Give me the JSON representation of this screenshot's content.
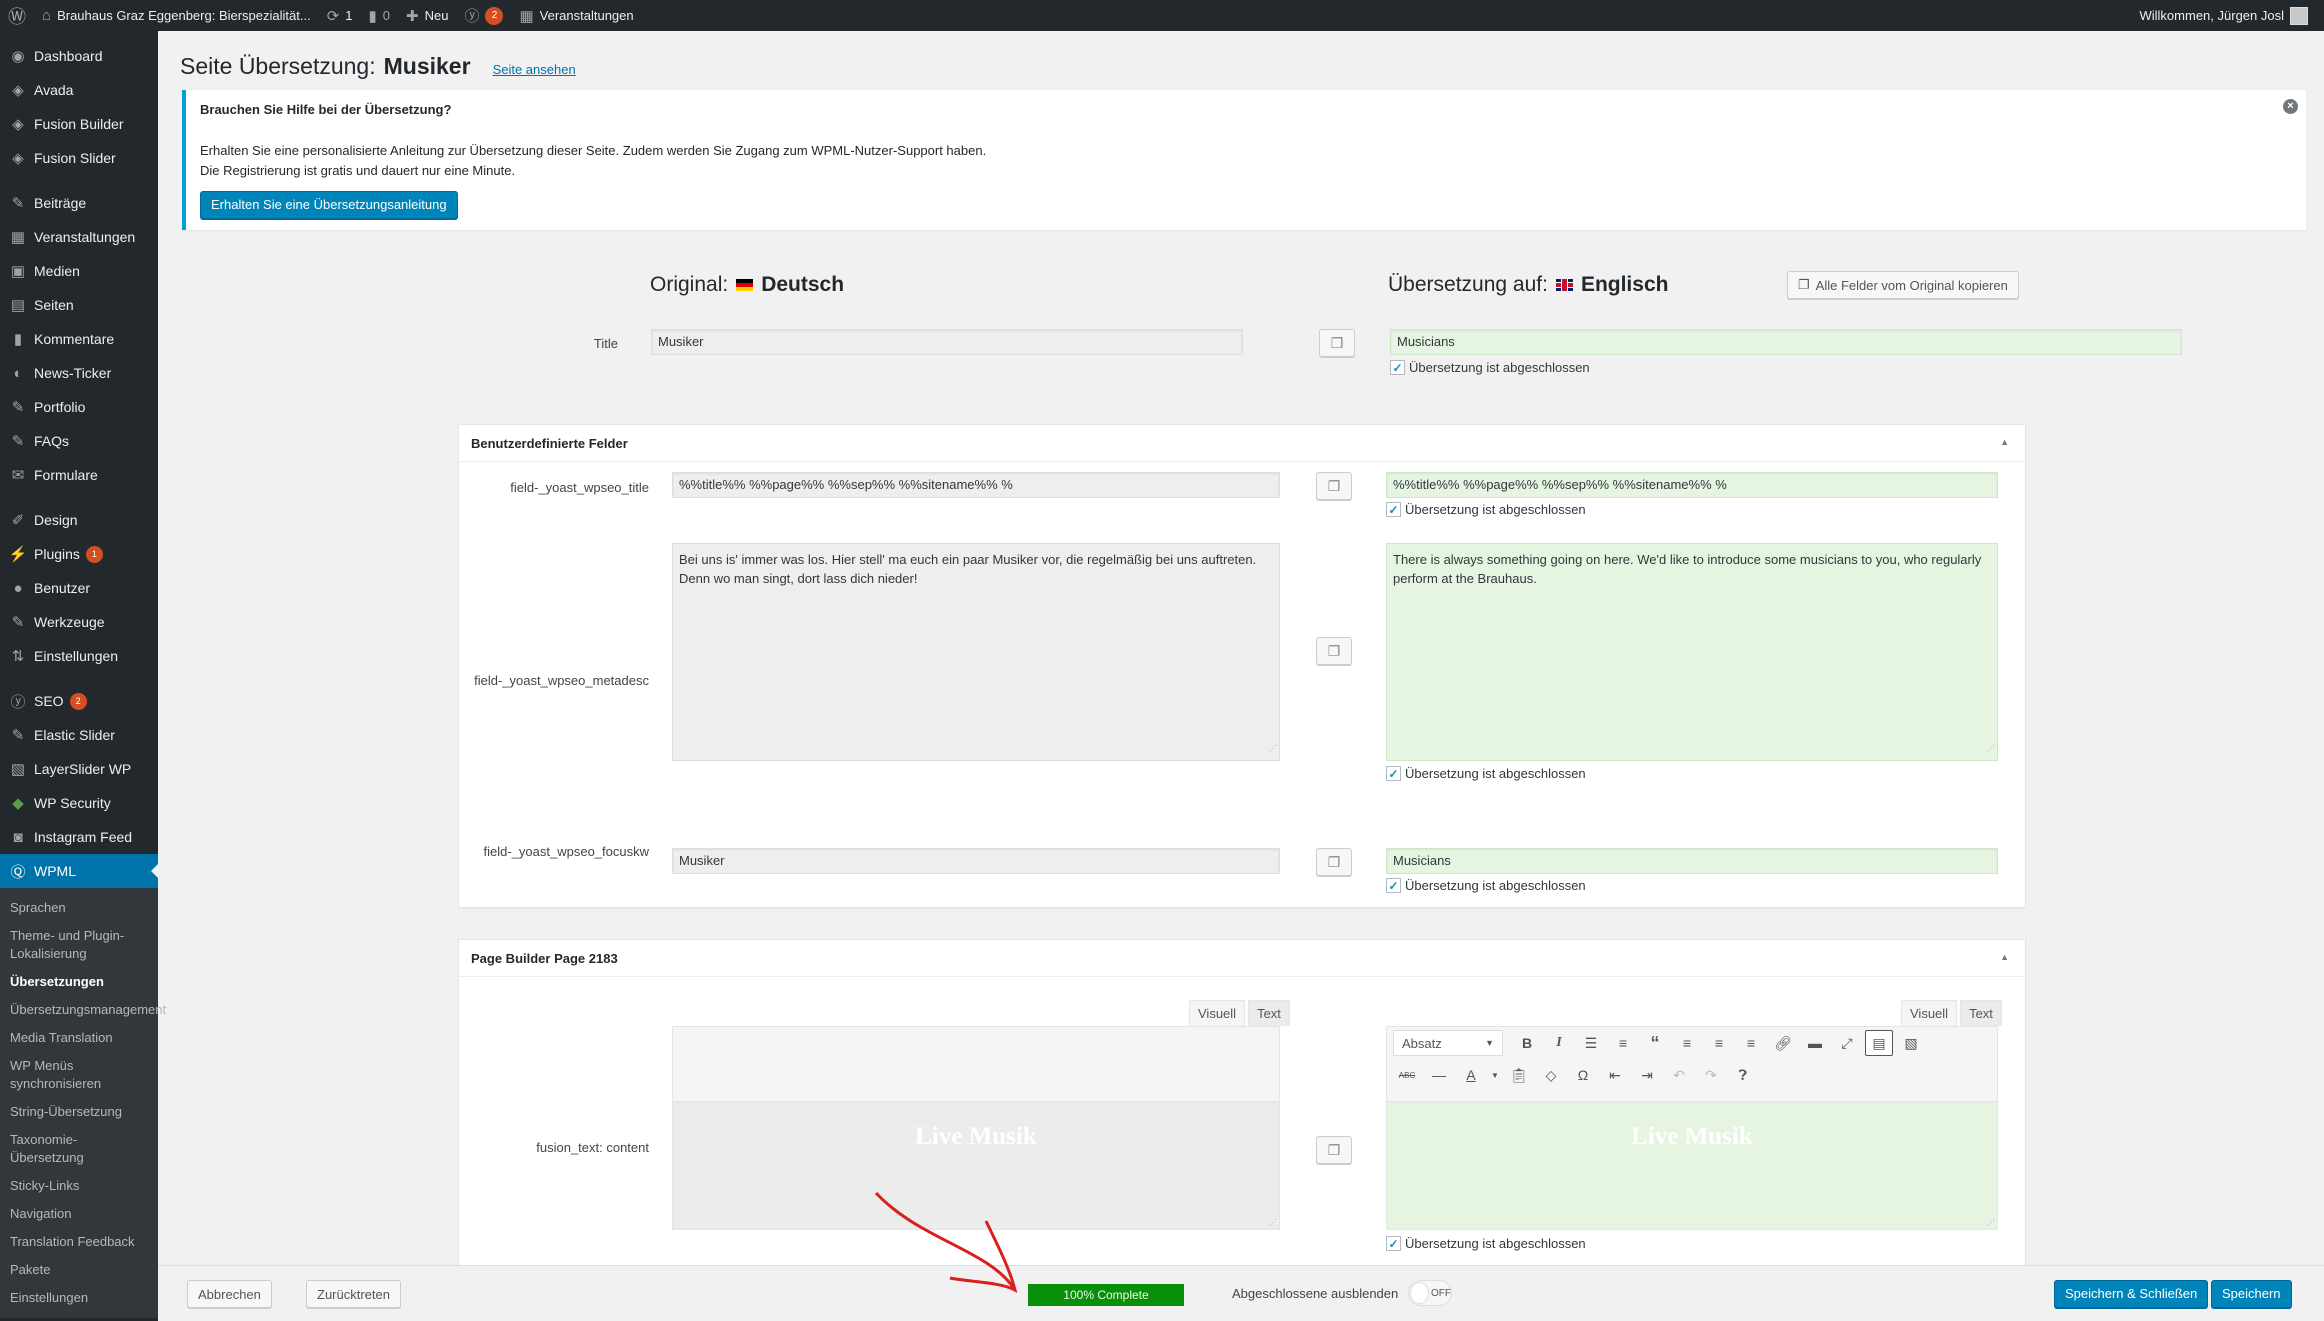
{
  "adminbar": {
    "site_name": "Brauhaus Graz Eggenberg: Bierspezialität...",
    "updates_count": "1",
    "comments_count": "0",
    "new_label": "Neu",
    "seo_badge": "2",
    "events_label": "Veranstaltungen",
    "greeting": "Willkommen, Jürgen Josl"
  },
  "sidebar": {
    "items": [
      {
        "label": "Dashboard",
        "icon": "dashboard-icon"
      },
      {
        "label": "Avada",
        "icon": "avada-icon"
      },
      {
        "label": "Fusion Builder",
        "icon": "fusion-icon"
      },
      {
        "label": "Fusion Slider",
        "icon": "fusion-icon"
      },
      {
        "label": "Beiträge",
        "icon": "pin-icon"
      },
      {
        "label": "Veranstaltungen",
        "icon": "calendar-icon"
      },
      {
        "label": "Medien",
        "icon": "media-icon"
      },
      {
        "label": "Seiten",
        "icon": "pages-icon"
      },
      {
        "label": "Kommentare",
        "icon": "comment-icon"
      },
      {
        "label": "News-Ticker",
        "icon": "ticker-icon"
      },
      {
        "label": "Portfolio",
        "icon": "pin-icon"
      },
      {
        "label": "FAQs",
        "icon": "pin-icon"
      },
      {
        "label": "Formulare",
        "icon": "mail-icon"
      },
      {
        "label": "Design",
        "icon": "brush-icon"
      },
      {
        "label": "Plugins",
        "icon": "plugin-icon",
        "badge": "1"
      },
      {
        "label": "Benutzer",
        "icon": "user-icon"
      },
      {
        "label": "Werkzeuge",
        "icon": "wrench-icon"
      },
      {
        "label": "Einstellungen",
        "icon": "settings-icon"
      },
      {
        "label": "SEO",
        "icon": "yoast-icon",
        "badge": "2"
      },
      {
        "label": "Elastic Slider",
        "icon": "pin-icon"
      },
      {
        "label": "LayerSlider WP",
        "icon": "layers-icon"
      },
      {
        "label": "WP Security",
        "icon": "shield-icon"
      },
      {
        "label": "Instagram Feed",
        "icon": "camera-icon"
      },
      {
        "label": "WPML",
        "icon": "wpml-icon"
      }
    ],
    "submenu": [
      "Sprachen",
      "Theme- und Plugin-Lokalisierung",
      "Übersetzungen",
      "Übersetzungsmanagement",
      "Media Translation",
      "WP Menüs synchronisieren",
      "String-Übersetzung",
      "Taxonomie-Übersetzung",
      "Sticky-Links",
      "Navigation",
      "Translation Feedback",
      "Pakete",
      "Einstellungen"
    ],
    "submenu_current": "Übersetzungen"
  },
  "page": {
    "title_prefix": "Seite Übersetzung:",
    "title_name": "Musiker",
    "view_link": "Seite ansehen"
  },
  "notice": {
    "heading": "Brauchen Sie Hilfe bei der Übersetzung?",
    "line1": "Erhalten Sie eine personalisierte Anleitung zur Übersetzung dieser Seite. Zudem werden Sie Zugang zum WPML-Nutzer-Support haben.",
    "line2": "Die Registrierung ist gratis und dauert nur eine Minute.",
    "button": "Erhalten Sie eine Übersetzungsanleitung"
  },
  "editor": {
    "original_label": "Original:",
    "original_lang": "Deutsch",
    "target_label": "Übersetzung auf:",
    "target_lang": "Englisch",
    "copy_all": "Alle Felder vom Original kopieren",
    "complete_label": "Übersetzung ist abgeschlossen",
    "title_field": {
      "label": "Title",
      "original": "Musiker",
      "translation": "Musicians",
      "complete": true
    },
    "custom_fields": {
      "heading": "Benutzerdefinierte Felder",
      "fields": [
        {
          "label": "field-_yoast_wpseo_title",
          "original": "%%title%% %%page%% %%sep%% %%sitename%% %",
          "translation": "%%title%% %%page%% %%sep%% %%sitename%% %",
          "complete": true
        },
        {
          "label": "field-_yoast_wpseo_metadesc",
          "original": "Bei uns is' immer was los. Hier stell' ma euch ein paar Musiker vor, die regelmäßig bei uns auftreten. Denn wo man singt, dort lass dich nieder!",
          "translation": "There is always something going on here. We'd like to introduce some musicians to you, who regularly perform at the Brauhaus.",
          "complete": true
        },
        {
          "label": "field-_yoast_wpseo_focuskw",
          "original": "Musiker",
          "translation": "Musicians",
          "complete": true
        }
      ]
    },
    "page_builder": {
      "heading": "Page Builder Page 2183",
      "field_label": "fusion_text: content",
      "tab_visual": "Visuell",
      "tab_text": "Text",
      "format_select": "Absatz",
      "original_content": "Live Musik",
      "translation_content": "Live Musik",
      "complete": true
    }
  },
  "footer": {
    "cancel": "Abbrechen",
    "resign": "Zurücktreten",
    "progress_percent": 100,
    "progress_label": "100% Complete",
    "hide_completed_label": "Abgeschlossene ausblenden",
    "toggle_state": "OFF",
    "save_close": "Speichern & Schließen",
    "save": "Speichern"
  }
}
